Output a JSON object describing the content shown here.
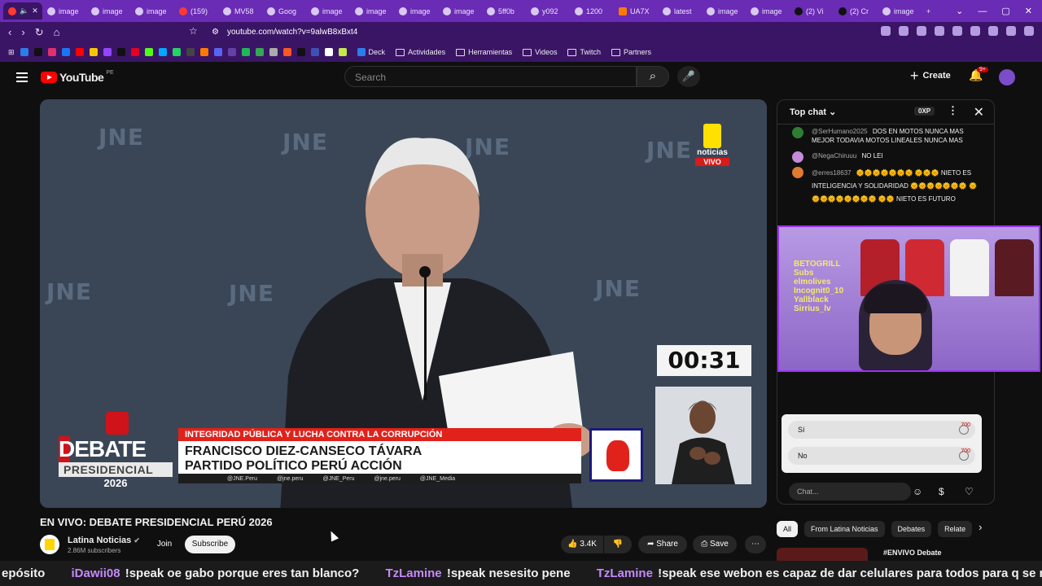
{
  "tabs": [
    "",
    "image",
    "image",
    "image",
    "(159)",
    "MV58",
    "Goog",
    "image",
    "image",
    "image",
    "image",
    "5ff0b",
    "y092",
    "1200",
    "UA7X",
    "latest",
    "image",
    "image",
    "(2) Vi",
    "(2) Cr",
    "image"
  ],
  "url": "youtube.com/watch?v=9alwB8xBxt4",
  "bookmarks": [
    "Deck",
    "Actividades",
    "Herramientas",
    "Videos",
    "Twitch",
    "Partners"
  ],
  "youtube": {
    "logo": "YouTube",
    "country": "PE",
    "search_placeholder": "Search",
    "create_label": "Create",
    "notif_badge": "9+"
  },
  "video": {
    "watermark": "JNE",
    "timer": "00:31",
    "noticias": "noticias",
    "vivo": "VIVO",
    "topic": "INTEGRIDAD PÚBLICA Y LUCHA CONTRA LA CORRUPCIÓN",
    "candidate": "FRANCISCO DIEZ-CANSECO TÁVARA",
    "party": "PARTIDO POLÍTICO PERÚ ACCIÓN",
    "socials": [
      "@JNE.Peru",
      "@jne.peru",
      "@JNE_Peru",
      "@jne.peru",
      "@JNE_Media"
    ],
    "debate_l1": "DEBATE",
    "debate_l2": "PRESIDENCIAL",
    "debate_l3": "2026"
  },
  "title": "EN VIVO: DEBATE PRESIDENCIAL PERÚ 2026",
  "channel": {
    "name": "Latina Noticias",
    "subscribers": "2.86M subscribers",
    "join": "Join",
    "subscribe": "Subscribe"
  },
  "actions": {
    "likes": "3.4K",
    "share": "Share",
    "save": "Save"
  },
  "chat": {
    "header": "Top chat",
    "xp": "0XP",
    "messages": [
      {
        "author": "@SerHumano2025",
        "text": "DOS EN MOTOS NUNCA MAS MEJOR TODAVIA MOTOS LINEALES NUNCA MAS",
        "color": "#2e7d32"
      },
      {
        "author": "@NegaChiruuu",
        "text": "NO LEI",
        "color": "#c48bd8"
      },
      {
        "author": "@erres18637",
        "text": "🌞🌞🌞🌞🌞🌞🌞 🌞🌞🌞 NIETO ES INTELIGENCIA Y SOLIDARIDAD 🌞🌞🌞🌞🌞🌞🌞 🌞🌞🌞🌞🌞🌞🌞🌞🌞 🌞🌞 NIETO ES FUTURO",
        "color": "#e07a2f"
      }
    ],
    "poll_options": [
      {
        "label": "Sí",
        "pct": "700"
      },
      {
        "label": "No",
        "pct": "700"
      }
    ],
    "input_placeholder": "Chat..."
  },
  "filters": [
    "All",
    "From Latina Noticias",
    "Debates",
    "Relate"
  ],
  "recommended": "#ENVIVO Debate",
  "ticker": [
    {
      "name": "",
      "text": "epósito"
    },
    {
      "name": "iDawii08",
      "text": "!speak oe gabo porque eres tan blanco?"
    },
    {
      "name": "TzLamine",
      "text": "!speak nesesito pene"
    },
    {
      "name": "TzLamine",
      "text": "!speak ese webon es capaz de dar celulares para todos para q se rastreen"
    }
  ],
  "cam_text": [
    "BETOGRILL",
    "Subs",
    "elmolives",
    "Incognit0_10",
    "Yallblack",
    "Sirrius_lv"
  ]
}
